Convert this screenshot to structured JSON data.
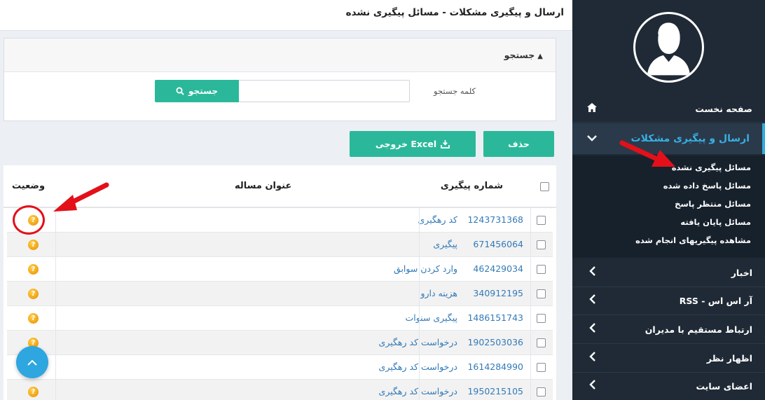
{
  "header": {
    "title": "ارسال و پیگیری مشکلات - مسائل پیگیری نشده"
  },
  "search": {
    "panel_title": "جستجو",
    "keyword_label": "کلمه جستجو",
    "keyword_value": "",
    "button_label": "جستجو"
  },
  "actions": {
    "delete_label": "حذف",
    "excel_label": "خروجی Excel"
  },
  "table": {
    "columns": {
      "tracking": "شماره پیگیری",
      "title": "عنوان مساله",
      "status": "وضعیت"
    },
    "rows": [
      {
        "tracking": "1243731368",
        "title": "کد رهگیری"
      },
      {
        "tracking": "671456064",
        "title": "پیگیری"
      },
      {
        "tracking": "462429034",
        "title": "وارد کردن سوابق"
      },
      {
        "tracking": "340912195",
        "title": "هزینه دارو"
      },
      {
        "tracking": "1486151743",
        "title": "پیگیری سنوات"
      },
      {
        "tracking": "1902503036",
        "title": "درخواست کد رهگیری"
      },
      {
        "tracking": "1614284990",
        "title": "درخواست کد رهگیری"
      },
      {
        "tracking": "1950215105",
        "title": "درخواست کد رهگیری"
      }
    ]
  },
  "sidebar": {
    "home": "صفحه نخست",
    "active_section": "ارسال و پیگیری مشکلات",
    "sub_items": [
      "مسائل پیگیری نشده",
      "مسائل پاسخ داده شده",
      "مسائل منتظر پاسخ",
      "مسائل پایان یافته",
      "مشاهده پیگیریهای انجام شده"
    ],
    "nav_items": [
      "اخبار",
      "آر اس اس - RSS",
      "ارتباط مستقیم با مدیران",
      "اظهار نظر",
      "اعضای سایت"
    ]
  },
  "colors": {
    "accent": "#2bb89a",
    "sidebar_bg": "#1f2a36",
    "active_text": "#39b0e4",
    "link": "#337ab7",
    "annotation": "#e3101a"
  }
}
